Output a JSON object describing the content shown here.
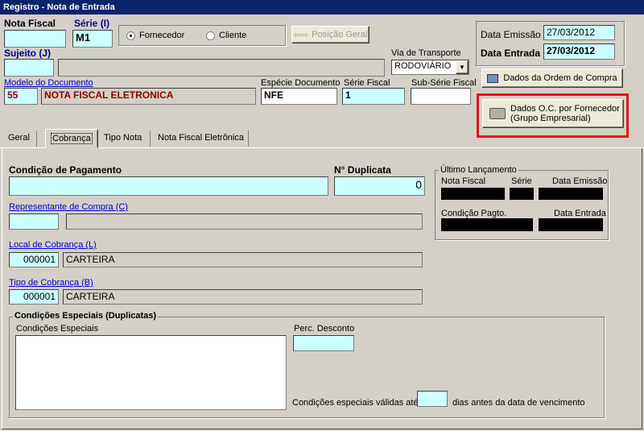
{
  "window": {
    "title": "Registro - Nota de Entrada"
  },
  "header": {
    "nota_fiscal": {
      "label": "Nota Fiscal",
      "value": ""
    },
    "serie": {
      "label": "Série (I)",
      "value": "M1"
    },
    "radio_fornecedor": {
      "label": "Fornecedor",
      "selected": true
    },
    "radio_cliente": {
      "label": "Cliente",
      "selected": false
    },
    "posicao_geral_button": "Posição Geral",
    "sujeito": {
      "label": "Sujeito (J)",
      "code": "",
      "name": ""
    },
    "via_transporte": {
      "label": "Via de Transporte",
      "value": "RODOVIÁRIO"
    },
    "modelo_documento": {
      "label": "Modelo do Documento",
      "code": "55",
      "name": "NOTA FISCAL ELETRONICA"
    },
    "especie_documento": {
      "label": "Espécie Documento",
      "value": "NFE"
    },
    "serie_fiscal": {
      "label": "Série Fiscal",
      "value": "1"
    },
    "sub_serie_fiscal": {
      "label": "Sub-Série Fiscal",
      "value": ""
    }
  },
  "dates": {
    "emissao": {
      "label": "Data Emissão",
      "value": "27/03/2012"
    },
    "entrada": {
      "label": "Data Entrada",
      "value": "27/03/2012"
    }
  },
  "buttons": {
    "ordem_compra": "Dados da Ordem de Compra",
    "oc_fornecedor_line1": "Dados O.C. por Fornecedor",
    "oc_fornecedor_line2": "(Grupo Empresarial)"
  },
  "tabs": [
    {
      "label": "Geral"
    },
    {
      "label": "Cobrança",
      "active": true
    },
    {
      "label": "Tipo Nota"
    },
    {
      "label": "Nota Fiscal Eletrônica"
    }
  ],
  "cobranca": {
    "condicao_pagamento": {
      "label": "Condição de Pagamento",
      "value": ""
    },
    "n_duplicata": {
      "label": "N° Duplicata",
      "value": "0"
    },
    "representante": {
      "label": "Representante de Compra (C)",
      "code": "",
      "name": ""
    },
    "local_cobranca": {
      "label": "Local de Cobrança (L)",
      "code": "000001",
      "name": "CARTEIRA"
    },
    "tipo_cobranca": {
      "label": "Tipo de Cobrança (B)",
      "code": "000001",
      "name": "CARTEIRA"
    }
  },
  "ultimo_lancamento": {
    "title": "Último Lançamento",
    "nota_fiscal": "Nota Fiscal",
    "serie": "Série",
    "data_emissao": "Data Emissão",
    "condicao_pagto": "Condição  Pagto.",
    "data_entrada": "Data Entrada"
  },
  "condicoes_especiais": {
    "title": "Condições Especiais (Duplicatas)",
    "textarea_label": "Condições Especiais",
    "perc_desconto_label": "Perc. Desconto",
    "validas_prefix": "Condições especiais válidas até",
    "validas_suffix": "dias antes da data de vencimento"
  },
  "colors": {
    "titlebar": "#0a246a",
    "input_bg": "#ccffff",
    "highlight": "#e0151b",
    "panel": "#d4d0c8"
  }
}
